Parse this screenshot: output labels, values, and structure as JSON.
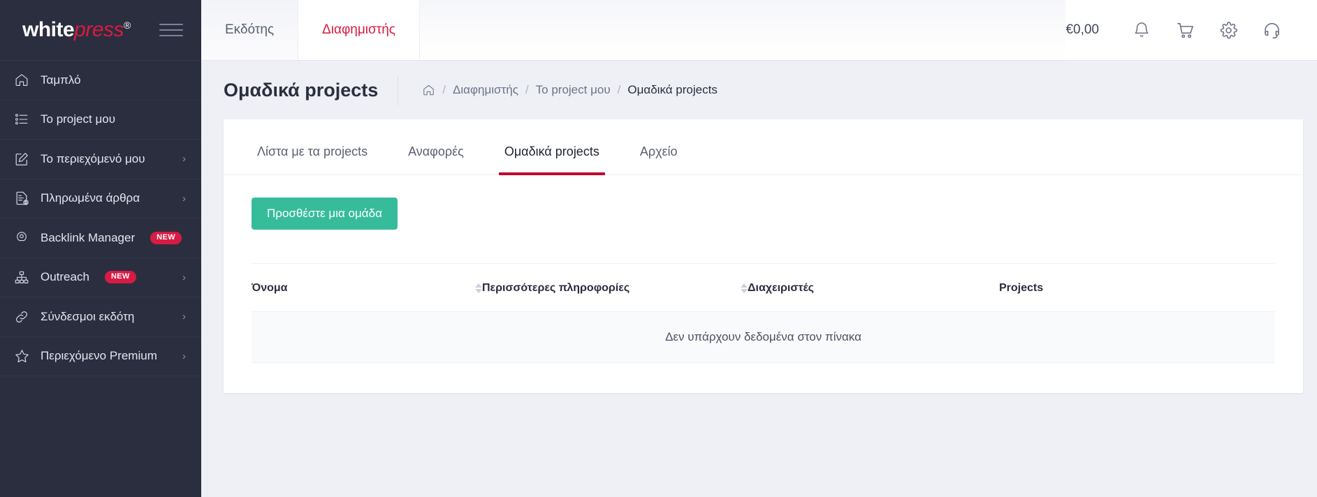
{
  "brand": {
    "part1": "white",
    "part2": "press",
    "reg": "®"
  },
  "sidebar": {
    "items": [
      {
        "label": "Ταμπλό",
        "icon": "home-icon",
        "badge": null,
        "chevron": false
      },
      {
        "label": "Το project μου",
        "icon": "list-icon",
        "badge": null,
        "chevron": false
      },
      {
        "label": "Το περιεχόμενό μου",
        "icon": "edit-document-icon",
        "badge": null,
        "chevron": true
      },
      {
        "label": "Πληρωμένα άρθρα",
        "icon": "paid-article-icon",
        "badge": null,
        "chevron": true
      },
      {
        "label": "Backlink Manager",
        "icon": "backlink-icon",
        "badge": "NEW",
        "chevron": false
      },
      {
        "label": "Outreach",
        "icon": "sitemap-icon",
        "badge": "NEW",
        "chevron": true
      },
      {
        "label": "Σύνδεσμοι εκδότη",
        "icon": "link-icon",
        "badge": null,
        "chevron": true
      },
      {
        "label": "Περιεχόμενο Premium",
        "icon": "star-icon",
        "badge": null,
        "chevron": true
      }
    ]
  },
  "topbar": {
    "tabs": [
      {
        "label": "Εκδότης",
        "active": false
      },
      {
        "label": "Διαφημιστής",
        "active": true
      }
    ],
    "balance": "€0,00",
    "icons": [
      "bell-icon",
      "cart-icon",
      "gear-icon",
      "headset-icon"
    ]
  },
  "page": {
    "title": "Ομαδικά projects",
    "breadcrumb": [
      {
        "label": "",
        "icon": "home-icon"
      },
      {
        "label": "Διαφημιστής"
      },
      {
        "label": "Το project μου"
      },
      {
        "label": "Ομαδικά projects",
        "current": true
      }
    ],
    "separator": "/"
  },
  "tabs": [
    {
      "label": "Λίστα με τα projects",
      "active": false
    },
    {
      "label": "Αναφορές",
      "active": false
    },
    {
      "label": "Ομαδικά projects",
      "active": true
    },
    {
      "label": "Αρχείο",
      "active": false
    }
  ],
  "actions": {
    "add_group_label": "Προσθέστε μια ομάδα"
  },
  "table": {
    "columns": [
      {
        "label": "Όνομα",
        "sortable": true
      },
      {
        "label": "Περισσότερες πληροφορίες",
        "sortable": true
      },
      {
        "label": "Διαχειριστές",
        "sortable": false
      },
      {
        "label": "Projects",
        "sortable": false
      }
    ],
    "rows": [],
    "empty_message": "Δεν υπάρχουν δεδομένα στον πίνακα"
  },
  "colors": {
    "sidebar_bg": "#2b2e3f",
    "accent_red": "#d81b43",
    "tab_underline": "#c2002f",
    "green_button": "#37bc9b",
    "page_bg": "#eef0f5"
  }
}
